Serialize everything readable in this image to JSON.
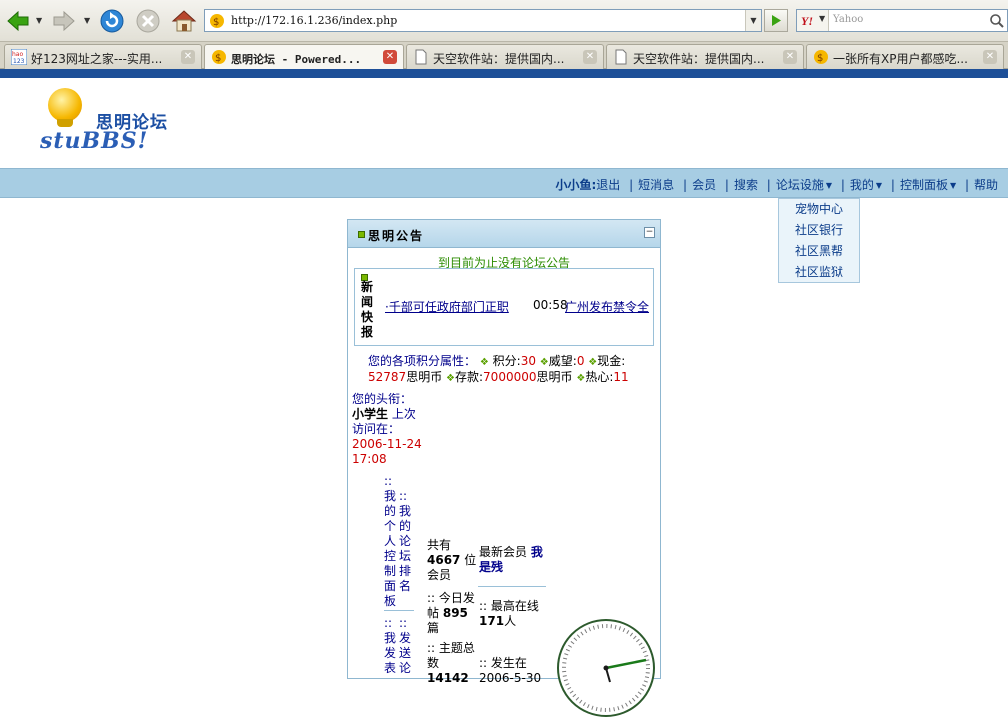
{
  "browser": {
    "url": "http://172.16.1.236/index.php",
    "search_placeholder": "Yahoo",
    "search_engine_label": "Y!",
    "tabs": [
      {
        "label": "好123网址之家---实用..."
      },
      {
        "label": "思明论坛 - Powered..."
      },
      {
        "label": "天空软件站：提供国内..."
      },
      {
        "label": "天空软件站：提供国内..."
      },
      {
        "label": "一张所有XP用户都感吃..."
      }
    ],
    "accent": "#1d4f98"
  },
  "site": {
    "logo_cn": "思明论坛",
    "logo_en": "stuBBS!"
  },
  "nav": {
    "username": "小小鱼:",
    "items": [
      "退出",
      "短消息",
      "会员",
      "搜索",
      "论坛设施",
      "我的",
      "控制面板",
      "帮助"
    ],
    "dropdown": [
      "宠物中心",
      "社区银行",
      "社区黑帮",
      "社区监狱"
    ]
  },
  "panel": {
    "title": "思明公告",
    "collapse_symbol": "−",
    "notice": "到目前为止没有论坛公告",
    "news_label": "新闻快报",
    "news": [
      {
        "text": "·千部可任政府部门正职"
      },
      {
        "time": "00:58",
        "text": "广州发布禁令全"
      }
    ],
    "score": {
      "label": "您的各项积分属性：",
      "points_label": "积分:",
      "points": "30",
      "prestige_label": "威望:",
      "prestige": "0",
      "cash_label": "现金:",
      "cash": "52787",
      "cash_unit": "思明币",
      "deposit_label": "存款:",
      "deposit": "7000000",
      "deposit_unit": "思明币",
      "enthusiasm_label": "热心:",
      "enthusiasm": "11"
    },
    "rank": {
      "title_label": "您的头衔：",
      "title_value": "小学生",
      "last_visit_label": "上次访问在：",
      "last_visit": "2006-11-24 17:08"
    },
    "links": {
      "my_panel": "::我的个人控制面板",
      "my_rank": "::我的论坛排名",
      "my_posts": "::我发表",
      "send": "::发送论"
    },
    "stats": {
      "members_prefix": "共有",
      "members": "4667",
      "members_suffix": "位会员",
      "newest_label": "最新会员",
      "newest": "我是残",
      "today_prefix": ":: 今日发帖",
      "today": "895",
      "today_suffix": "篇",
      "online_label": ":: 最高在线",
      "online": "171",
      "online_suffix": "人",
      "topics_label": ":: 主题总数",
      "topics": "14142",
      "happened_label": ":: 发生在",
      "happened": "2006-5-30"
    }
  }
}
